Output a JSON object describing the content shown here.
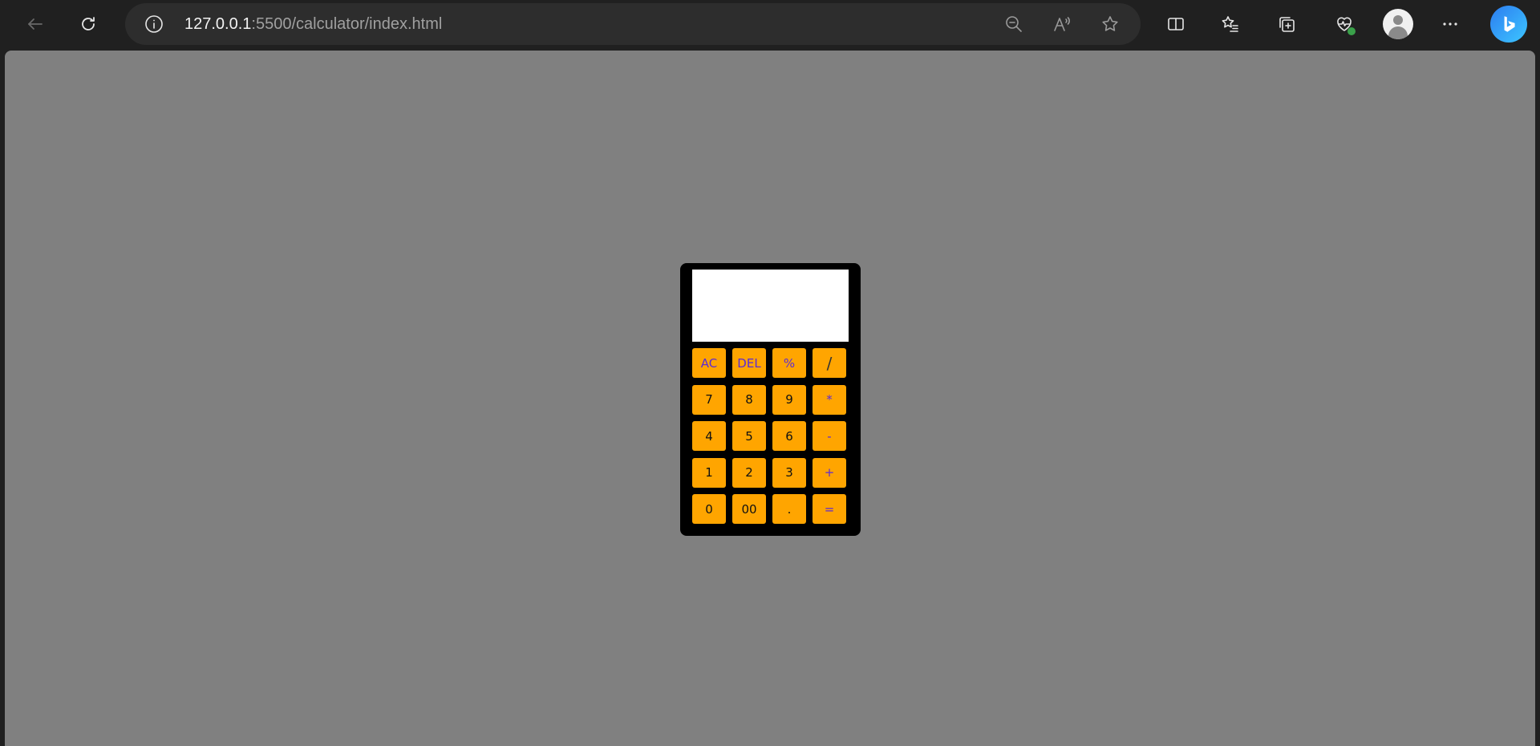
{
  "browser": {
    "url_host": "127.0.0.1",
    "url_rest": ":5500/calculator/index.html",
    "icons": {
      "back": "back-arrow-icon",
      "refresh": "refresh-icon",
      "info": "info-icon",
      "zoom_out": "zoom-out-icon",
      "read_aloud": "read-aloud-icon",
      "favorite": "star-icon",
      "split_screen": "split-screen-icon",
      "favorites": "favorites-icon",
      "collections": "collections-icon",
      "health": "browser-essentials-icon",
      "profile": "profile-avatar",
      "more": "more-dots-icon",
      "copilot": "bing-copilot-icon"
    }
  },
  "calculator": {
    "display_value": "",
    "keys": [
      {
        "label": "AC",
        "kind": "fn"
      },
      {
        "label": "DEL",
        "kind": "fn"
      },
      {
        "label": "%",
        "kind": "op"
      },
      {
        "label": "/",
        "kind": "op-slash"
      },
      {
        "label": "7",
        "kind": "num"
      },
      {
        "label": "8",
        "kind": "num"
      },
      {
        "label": "9",
        "kind": "num"
      },
      {
        "label": "*",
        "kind": "op"
      },
      {
        "label": "4",
        "kind": "num"
      },
      {
        "label": "5",
        "kind": "num"
      },
      {
        "label": "6",
        "kind": "num"
      },
      {
        "label": "-",
        "kind": "op"
      },
      {
        "label": "1",
        "kind": "num"
      },
      {
        "label": "2",
        "kind": "num"
      },
      {
        "label": "3",
        "kind": "num"
      },
      {
        "label": "+",
        "kind": "op"
      },
      {
        "label": "0",
        "kind": "num"
      },
      {
        "label": "00",
        "kind": "num"
      },
      {
        "label": ".",
        "kind": "num"
      },
      {
        "label": "=",
        "kind": "op"
      }
    ]
  },
  "colors": {
    "page_background": "#808080",
    "calculator_body": "#000000",
    "key_background": "#ffa500",
    "operator_text": "#5b2bd6"
  }
}
